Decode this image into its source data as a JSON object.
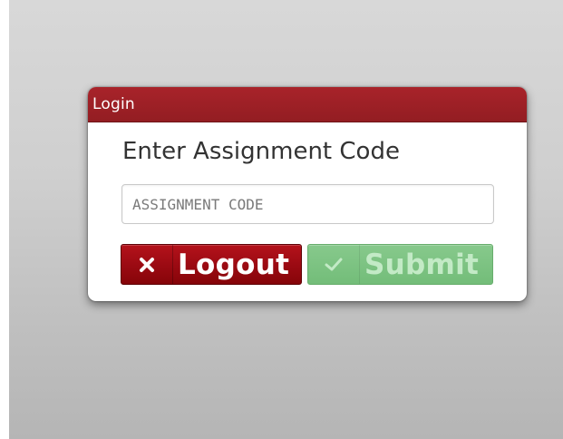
{
  "dialog": {
    "title": "Login",
    "prompt": "Enter Assignment Code",
    "input": {
      "placeholder": "ASSIGNMENT CODE",
      "value": ""
    },
    "buttons": {
      "logout": {
        "label": "Logout",
        "icon": "close-icon",
        "color": "#9a0a12"
      },
      "submit": {
        "label": "Submit",
        "icon": "checkmark-icon",
        "color": "#7cc282",
        "state": "disabled"
      }
    },
    "header_color": "#9c2026"
  }
}
